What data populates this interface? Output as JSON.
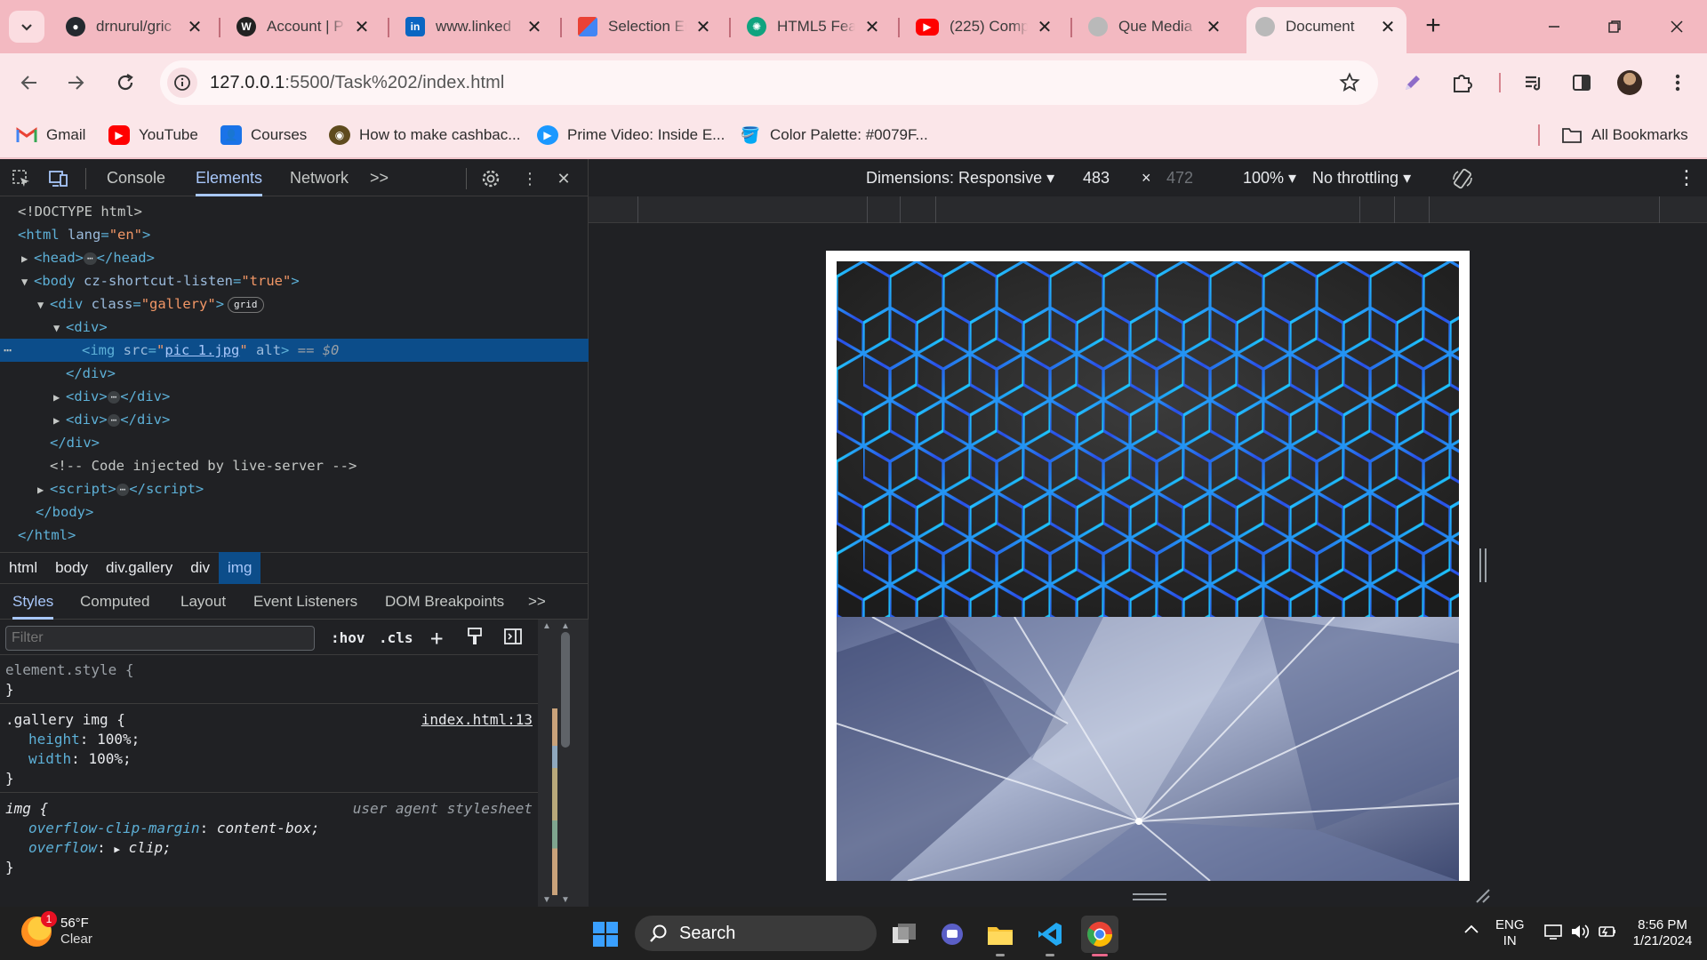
{
  "browser": {
    "tabs": [
      {
        "title": "drnurul/gric",
        "icon": "github-icon",
        "color": "#24292f"
      },
      {
        "title": "Account | P",
        "icon": "wordpress-icon",
        "color": "#222222"
      },
      {
        "title": "www.linked",
        "icon": "linkedin-icon",
        "color": "#0a66c2"
      },
      {
        "title": "Selection Er",
        "icon": "colorful-puzzle-icon",
        "color": "#e94235"
      },
      {
        "title": "HTML5 Feat",
        "icon": "chatgpt-icon",
        "color": "#10a37f"
      },
      {
        "title": "(225) Comp",
        "icon": "youtube-icon",
        "color": "#ff0000"
      },
      {
        "title": "Que Media",
        "icon": "globe-icon",
        "color": "#9e9e9e"
      },
      {
        "title": "Document",
        "icon": "globe-icon",
        "color": "#9e9e9e"
      }
    ],
    "address": {
      "host": "127.0.0.1",
      "path": ":5500/Task%202/index.html"
    },
    "bookmarks": [
      {
        "label": "Gmail",
        "icon": "gmail-icon",
        "color": "#ea4335"
      },
      {
        "label": "YouTube",
        "icon": "youtube-icon",
        "color": "#ff0000"
      },
      {
        "label": "Courses",
        "icon": "google-classroom-icon",
        "color": "#1e8e3e"
      },
      {
        "label": "How to make cashbac...",
        "icon": "coin-icon",
        "color": "#5f4b1e"
      },
      {
        "label": "Prime Video: Inside E...",
        "icon": "prime-video-icon",
        "color": "#1a98ff"
      },
      {
        "label": "Color Palette: #0079F...",
        "icon": "paint-bucket-icon",
        "color": "#d4a017"
      }
    ],
    "all_bookmarks": "All Bookmarks"
  },
  "devtools": {
    "tabs": [
      "Console",
      "Elements",
      "Network"
    ],
    "more": ">>",
    "dom": {
      "doctype": "<!DOCTYPE html>",
      "html_open_tag": "<html",
      "lang_attr": "lang",
      "lang_val": "\"en\"",
      "head": "head",
      "body_attr": "cz-shortcut-listen",
      "body_val": "\"true\"",
      "gallery_class": "\"gallery\"",
      "grid_badge": "grid",
      "img_src": "pic 1.jpg",
      "dollar": "== $0",
      "comment": "<!-- Code injected by live-server -->"
    },
    "breadcrumbs": [
      "html",
      "body",
      "div.gallery",
      "div",
      "img"
    ],
    "sub_tabs": [
      "Styles",
      "Computed",
      "Layout",
      "Event Listeners",
      "DOM Breakpoints"
    ],
    "filter_placeholder": "Filter",
    "hov": ":hov",
    "cls": ".cls",
    "rules": {
      "element_style": "element.style {",
      "gallery_selector": ".gallery img {",
      "gallery_source": "index.html:13",
      "height_prop": "height",
      "height_val": "100%;",
      "width_prop": "width",
      "width_val": "100%;",
      "img_selector": "img {",
      "ua_source": "user agent stylesheet",
      "ocm_prop": "overflow-clip-margin",
      "ocm_val": "content-box;",
      "overflow_prop": "overflow",
      "overflow_val": "clip;"
    }
  },
  "device_toolbar": {
    "dimensions": "Dimensions: Responsive",
    "width": "483",
    "times": "×",
    "height": "472",
    "zoom": "100%",
    "throttling": "No throttling"
  },
  "taskbar": {
    "temp": "56°F",
    "condition": "Clear",
    "weather_badge": "1",
    "search": "Search",
    "lang_top": "ENG",
    "lang_bottom": "IN",
    "time": "8:56 PM",
    "date": "1/21/2024"
  }
}
